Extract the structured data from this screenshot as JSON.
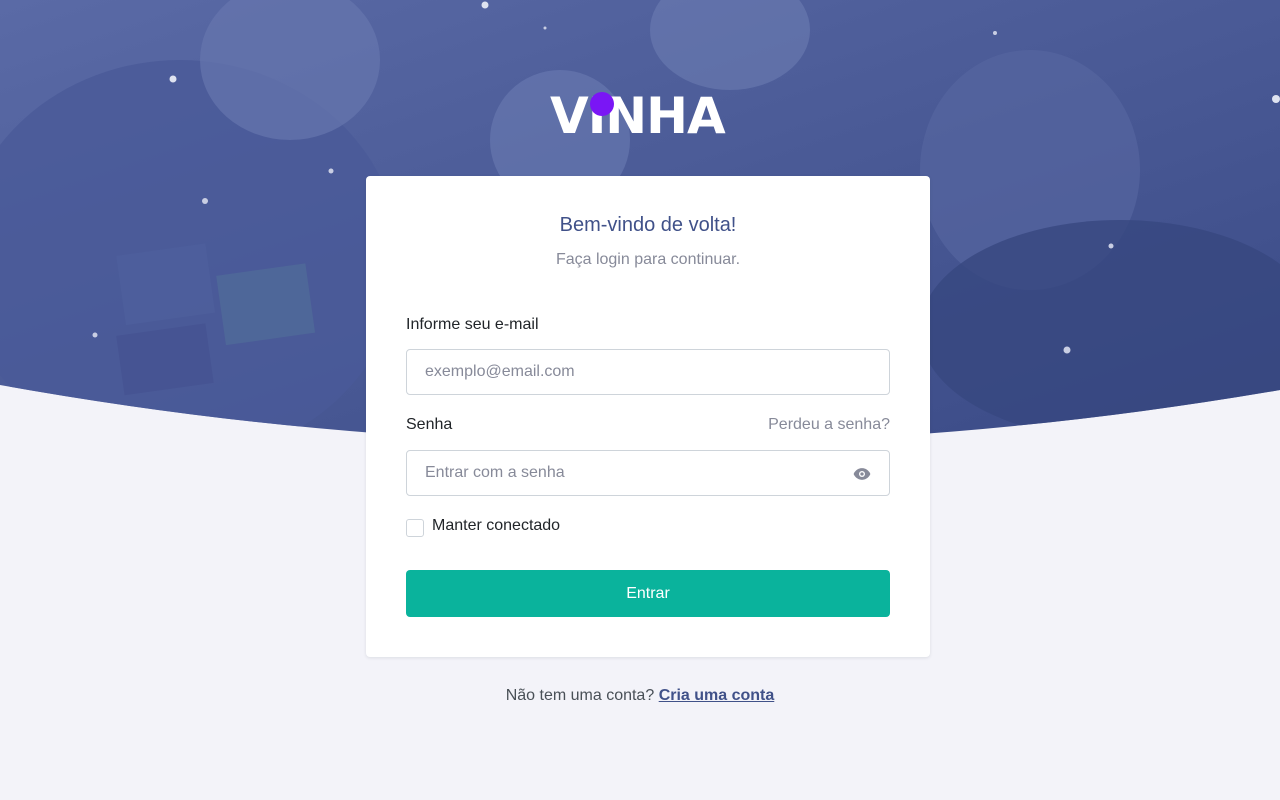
{
  "brand": {
    "logo_text": "VINHA",
    "dot_color": "#7a16f5"
  },
  "colors": {
    "hero_overlay": "#405189",
    "accent": "#0ab39c",
    "page_bg": "#f3f3f9"
  },
  "login": {
    "title": "Bem-vindo de volta!",
    "subtitle": "Faça login para continuar.",
    "email_label": "Informe seu e-mail",
    "email_placeholder": "exemplo@email.com",
    "email_value": "",
    "password_label": "Senha",
    "forgot_link": "Perdeu a senha?",
    "password_placeholder": "Entrar com a senha",
    "password_value": "",
    "password_toggle_icon": "eye-icon",
    "remember_label": "Manter conectado",
    "remember_checked": false,
    "submit_label": "Entrar"
  },
  "footer": {
    "prompt": "Não tem uma conta?",
    "signup_link": "Cria uma conta"
  }
}
